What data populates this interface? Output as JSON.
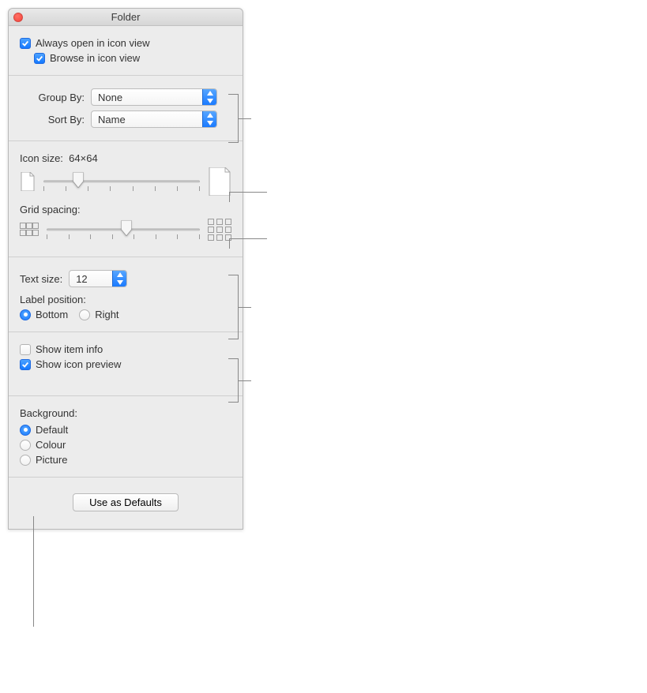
{
  "window": {
    "title": "Folder"
  },
  "top": {
    "always_open_label": "Always open in icon view",
    "always_open_checked": true,
    "browse_label": "Browse in icon view",
    "browse_checked": true
  },
  "arrange": {
    "group_by_label": "Group By:",
    "group_by_value": "None",
    "sort_by_label": "Sort By:",
    "sort_by_value": "Name"
  },
  "sizing": {
    "icon_size_label": "Icon size:",
    "icon_size_value": "64×64",
    "icon_slider_percent": 22,
    "grid_spacing_label": "Grid spacing:",
    "grid_slider_percent": 52
  },
  "text": {
    "text_size_label": "Text size:",
    "text_size_value": "12",
    "label_position_label": "Label position:",
    "bottom": "Bottom",
    "right": "Right",
    "selected_position": "bottom"
  },
  "show": {
    "item_info_label": "Show item info",
    "item_info_checked": false,
    "icon_preview_label": "Show icon preview",
    "icon_preview_checked": true
  },
  "background": {
    "label": "Background:",
    "default": "Default",
    "colour": "Colour",
    "picture": "Picture",
    "selected": "default"
  },
  "footer": {
    "use_defaults_label": "Use as Defaults"
  }
}
